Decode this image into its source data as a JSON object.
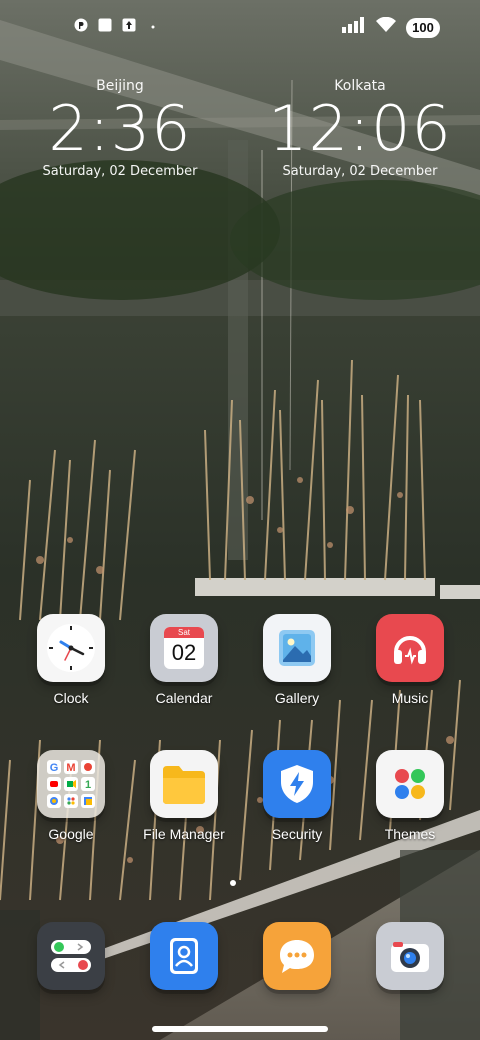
{
  "status_bar": {
    "battery": "100",
    "left_icons": [
      "notification-app-icon",
      "square-notification-icon",
      "upload-notification-icon",
      "dot-icon"
    ],
    "right_icons": [
      "signal-icon",
      "wifi-icon",
      "battery-icon"
    ]
  },
  "clocks": [
    {
      "city": "Beijing",
      "time": "2:36",
      "date": "Saturday, 02 December"
    },
    {
      "city": "Kolkata",
      "time": "12:06",
      "date": "Saturday, 02 December"
    }
  ],
  "apps": [
    {
      "label": "Clock",
      "icon": "clock-icon"
    },
    {
      "label": "Calendar",
      "icon": "calendar-icon",
      "calendar_day": "Sat",
      "calendar_date": "02"
    },
    {
      "label": "Gallery",
      "icon": "gallery-icon"
    },
    {
      "label": "Music",
      "icon": "headphones-icon"
    },
    {
      "label": "Google",
      "icon": "google-folder-icon"
    },
    {
      "label": "File Manager",
      "icon": "folder-icon"
    },
    {
      "label": "Security",
      "icon": "shield-icon"
    },
    {
      "label": "Themes",
      "icon": "themes-icon"
    }
  ],
  "dock": [
    {
      "icon": "phone-icon"
    },
    {
      "icon": "contacts-icon"
    },
    {
      "icon": "messages-icon"
    },
    {
      "icon": "camera-icon"
    }
  ],
  "colors": {
    "music": "#e8494f",
    "files": "#f7b81c",
    "security": "#2f80ed",
    "contacts": "#2f80ed",
    "messages": "#f6a33a"
  }
}
